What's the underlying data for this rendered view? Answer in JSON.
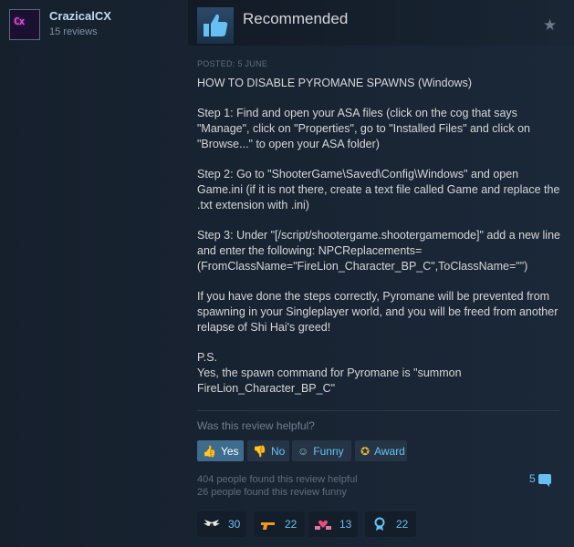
{
  "author": {
    "name": "CrazicalCX",
    "reviews": "15 reviews",
    "avatar_glyph": "Cx"
  },
  "review": {
    "verdict": "Recommended",
    "posted": "POSTED: 5 JUNE",
    "paragraphs": [
      "HOW TO DISABLE PYROMANE SPAWNS (Windows)",
      "Step 1: Find and open your ASA files (click on the cog that says \"Manage\", click on \"Properties\", go to \"Installed Files\" and click on \"Browse...\" to open your ASA folder)",
      "Step 2: Go to \"ShooterGame\\Saved\\Config\\Windows\" and open Game.ini (if it is not there, create a text file called Game and replace the .txt extension with .ini)",
      "Step 3: Under \"[/script/shootergame.shootergamemode]\" add a new line and enter the following: NPCReplacements=(FromClassName=\"FireLion_Character_BP_C\",ToClassName=\"\")",
      "If you have done the steps correctly, Pyromane will be prevented from spawning in your Singleplayer world, and you will be freed from another relapse of Shi Hai's greed!",
      "P.S.\nYes, the spawn command for Pyromane is \"summon FireLion_Character_BP_C\""
    ]
  },
  "helpful": {
    "question": "Was this review helpful?",
    "buttons": {
      "yes": "Yes",
      "no": "No",
      "funny": "Funny",
      "award": "Award"
    },
    "helpful_stat": "404 people found this review helpful",
    "funny_stat": "26 people found this review funny",
    "comment_count": "5"
  },
  "awards": [
    {
      "icon": "wings-award-icon",
      "count": "30"
    },
    {
      "icon": "gun-award-icon",
      "count": "22"
    },
    {
      "icon": "heart-hands-award-icon",
      "count": "13"
    },
    {
      "icon": "medal-award-icon",
      "count": "22"
    }
  ],
  "colors": {
    "background": "#1b2838",
    "accent": "#66c0f4",
    "yes_button": "#3d6c8d"
  }
}
